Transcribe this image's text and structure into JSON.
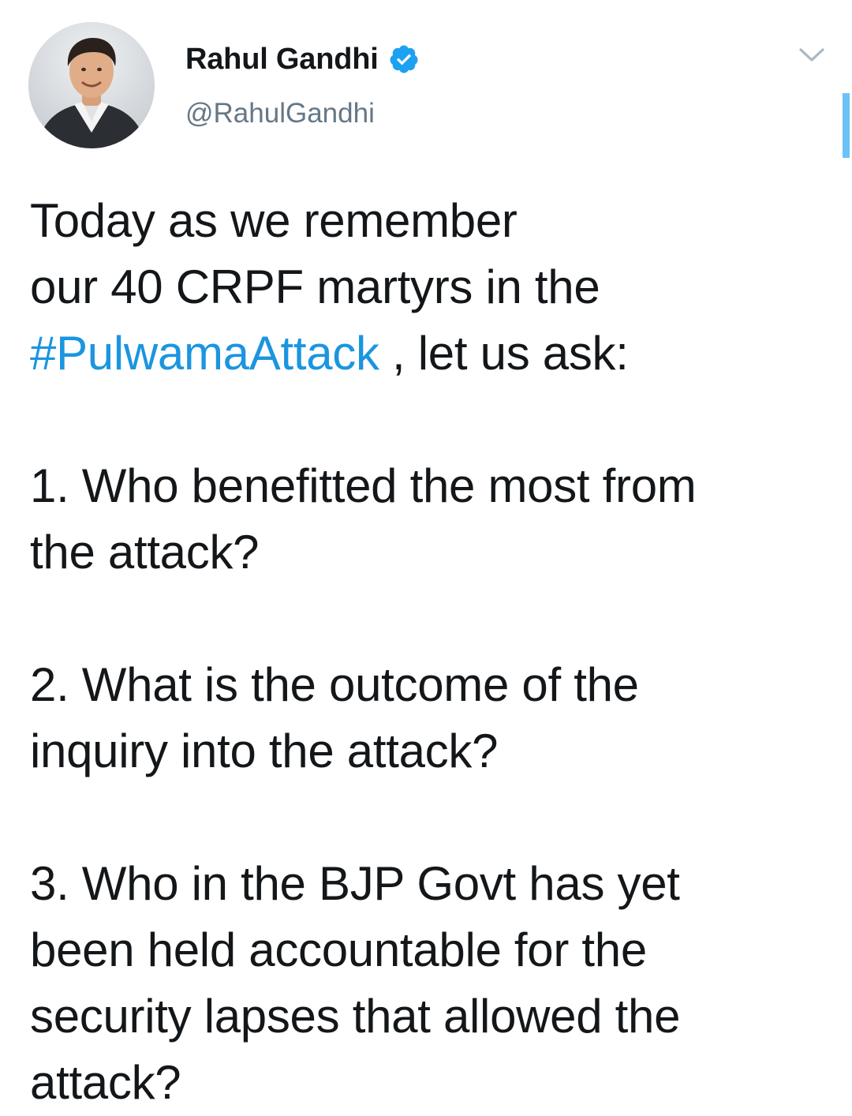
{
  "author": {
    "display_name": "Rahul Gandhi",
    "handle": "@RahulGandhi",
    "verified": true,
    "avatar_icon": "profile-photo"
  },
  "icons": {
    "verified": "verified-badge-icon",
    "menu": "chevron-down-icon"
  },
  "colors": {
    "link": "#1b95e0",
    "verified": "#1da1f2",
    "text": "#14171a",
    "secondary": "#657786"
  },
  "tweet": {
    "line1": "Today as we remember",
    "line2": "our 40 CRPF martyrs in the",
    "hashtag": "#PulwamaAttack",
    "after_hashtag": " , let us ask:",
    "q1_line1": "1. Who benefitted the most from",
    "q1_line2": "the attack?",
    "q2_line1": "2. What is the outcome of the",
    "q2_line2": "inquiry into the attack?",
    "q3_line1": "3. Who in the BJP Govt has yet",
    "q3_line2": "been held accountable for the",
    "q3_line3": "security lapses that allowed the",
    "q3_line4": "attack?"
  }
}
